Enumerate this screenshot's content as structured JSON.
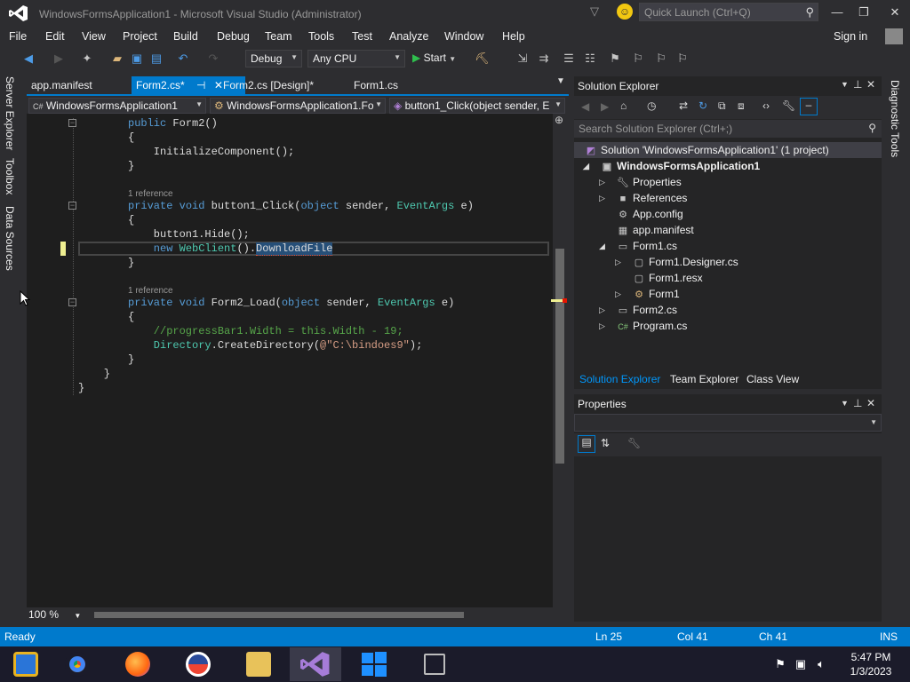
{
  "window": {
    "title": "WindowsFormsApplication1 - Microsoft Visual Studio (Administrator)",
    "quick_launch_placeholder": "Quick Launch (Ctrl+Q)"
  },
  "menu": [
    "File",
    "Edit",
    "View",
    "Project",
    "Build",
    "Debug",
    "Team",
    "Tools",
    "Test",
    "Analyze",
    "Window",
    "Help"
  ],
  "signin": "Sign in",
  "toolbar": {
    "config": "Debug",
    "platform": "Any CPU",
    "start": "Start"
  },
  "left_strip": [
    "Server Explorer",
    "Toolbox",
    "Data Sources"
  ],
  "doc_tabs": [
    {
      "label": "app.manifest"
    },
    {
      "label": "Form2.cs*",
      "pin": "⊣",
      "close": "✕"
    },
    {
      "label": "Form2.cs [Design]*"
    },
    {
      "label": "Form1.cs"
    }
  ],
  "nav": {
    "project": "WindowsFormsApplication1",
    "class": "WindowsFormsApplication1.Fo",
    "member": "button1_Click(object sender, E"
  },
  "code": {
    "l1_kw": "public",
    "l1_rest": " Form2()",
    "l2": "{",
    "l3": "    InitializeComponent();",
    "l4": "}",
    "ref1": "1 reference",
    "l5_kw1": "private",
    "l5_kw2": " void",
    "l5_name": " button1_Click(",
    "l5_kw3": "object",
    "l5_p1": " sender, ",
    "l5_ty": "EventArgs",
    "l5_p2": " e)",
    "l6": "{",
    "l7": "    button1.Hide();",
    "l8_kw": "    new",
    "l8_ty": " WebClient",
    "l8_mid": "().",
    "l8_sel": "DownloadFile",
    "l9": "}",
    "ref2": "1 reference",
    "l10_kw1": "private",
    "l10_kw2": " void",
    "l10_name": " Form2_Load(",
    "l10_kw3": "object",
    "l10_p1": " sender, ",
    "l10_ty": "EventArgs",
    "l10_p2": " e)",
    "l11": "{",
    "l12": "    //progressBar1.Width = this.Width - 19;",
    "l13_ty": "    Directory",
    "l13_mid": ".CreateDirectory(",
    "l13_str": "@\"C:\\bindoes9\"",
    "l13_end": ");",
    "l14": "}",
    "l15": "    }",
    "l16": "}"
  },
  "zoom": "100 %",
  "solution_explorer": {
    "title": "Solution Explorer",
    "search_placeholder": "Search Solution Explorer (Ctrl+;)",
    "tree": [
      {
        "label": "Solution 'WindowsFormsApplication1' (1 project)",
        "icon": "solution-icon"
      },
      {
        "label": "WindowsFormsApplication1",
        "icon": "csharp-project-icon"
      },
      {
        "label": "Properties",
        "icon": "wrench-icon"
      },
      {
        "label": "References",
        "icon": "references-icon"
      },
      {
        "label": "App.config",
        "icon": "config-icon"
      },
      {
        "label": "app.manifest",
        "icon": "manifest-icon"
      },
      {
        "label": "Form1.cs",
        "icon": "form-icon"
      },
      {
        "label": "Form1.Designer.cs",
        "icon": "designer-file-icon"
      },
      {
        "label": "Form1.resx",
        "icon": "resx-icon"
      },
      {
        "label": "Form1",
        "icon": "class-icon"
      },
      {
        "label": "Form2.cs",
        "icon": "form-icon"
      },
      {
        "label": "Program.cs",
        "icon": "csharp-file-icon"
      }
    ],
    "tabs": [
      "Solution Explorer",
      "Team Explorer",
      "Class View"
    ]
  },
  "properties": {
    "title": "Properties"
  },
  "right_strip": "Diagnostic Tools",
  "status": {
    "state": "Ready",
    "ln": "Ln 25",
    "col": "Col 41",
    "ch": "Ch 41",
    "mode": "INS"
  },
  "clock": {
    "time": "5:47 PM",
    "date": "1/3/2023"
  },
  "colors": {
    "accent": "#007acc",
    "editor_bg": "#1e1e1e",
    "keyword": "#569cd6",
    "type": "#4ec9b0",
    "comment": "#57a64a",
    "string": "#d69d85"
  }
}
